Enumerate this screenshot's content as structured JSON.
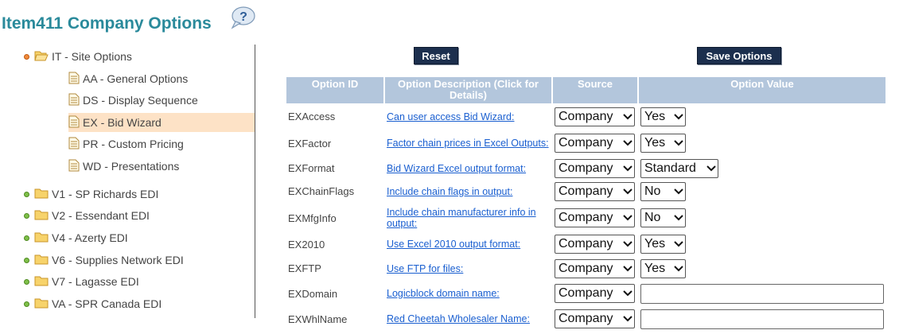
{
  "page": {
    "title": "Item411 Company Options",
    "help_icon": "question-bubble-icon"
  },
  "buttons": {
    "reset": "Reset",
    "save": "Save Options"
  },
  "tree": {
    "root": {
      "label": "IT - Site Options"
    },
    "children": [
      {
        "label": "AA - General Options",
        "selected": false
      },
      {
        "label": "DS - Display Sequence",
        "selected": false
      },
      {
        "label": "EX - Bid Wizard",
        "selected": true
      },
      {
        "label": "PR - Custom Pricing",
        "selected": false
      },
      {
        "label": "WD - Presentations",
        "selected": false
      }
    ],
    "siblings": [
      {
        "label": "V1 - SP Richards EDI"
      },
      {
        "label": "V2 - Essendant EDI"
      },
      {
        "label": "V4 - Azerty EDI"
      },
      {
        "label": "V6 - Supplies Network EDI"
      },
      {
        "label": "V7 - Lagasse EDI"
      },
      {
        "label": "VA - SPR Canada EDI"
      }
    ]
  },
  "table": {
    "headers": [
      "Option ID",
      "Option Description (Click for Details)",
      "Source",
      "Option Value"
    ],
    "rows": [
      {
        "id": "EXAccess",
        "desc": "Can user access Bid Wizard:",
        "source": "Company",
        "value": "Yes",
        "value_type": "select"
      },
      {
        "id": "EXFactor",
        "desc": "Factor chain prices in Excel Outputs:",
        "source": "Company",
        "value": "Yes",
        "value_type": "select"
      },
      {
        "id": "EXFormat",
        "desc": "Bid Wizard Excel output format:",
        "source": "Company",
        "value": "Standard",
        "value_type": "select"
      },
      {
        "id": "EXChainFlags",
        "desc": "Include chain flags in output:",
        "source": "Company",
        "value": "No",
        "value_type": "select"
      },
      {
        "id": "EXMfgInfo",
        "desc": "Include chain manufacturer info in output:",
        "source": "Company",
        "value": "No",
        "value_type": "select"
      },
      {
        "id": "EX2010",
        "desc": "Use Excel 2010 output format:",
        "source": "Company",
        "value": "Yes",
        "value_type": "select"
      },
      {
        "id": "EXFTP",
        "desc": "Use FTP for files:",
        "source": "Company",
        "value": "Yes",
        "value_type": "select"
      },
      {
        "id": "EXDomain",
        "desc": "Logicblock domain name:",
        "source": "Company",
        "value": "",
        "value_type": "text"
      },
      {
        "id": "EXWhlName",
        "desc": "Red Cheetah Wholesaler Name:",
        "source": "Company",
        "value": "",
        "value_type": "text"
      }
    ]
  }
}
